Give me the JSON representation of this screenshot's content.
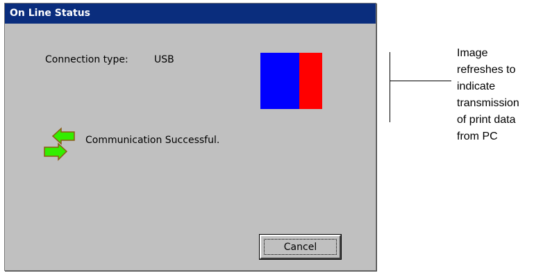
{
  "dialog": {
    "title": "On Line Status",
    "connection_label": "Connection type:",
    "connection_value": "USB",
    "status_message": "Communication Successful.",
    "cancel_label": "Cancel",
    "icons": {
      "transmission_image": "transmission-status-icon",
      "communication": "communication-arrows-icon"
    }
  },
  "callout": {
    "lines": [
      "Image",
      "refreshes to",
      "indicate",
      "transmission",
      "of print data",
      "from PC"
    ]
  },
  "colors": {
    "titlebar": "#0a2d7d",
    "dialog_bg": "#c0c0c0",
    "image_left": "#0000ff",
    "image_right": "#ff0000",
    "arrow_green": "#33ee00",
    "arrow_outline": "#8a5a14"
  }
}
